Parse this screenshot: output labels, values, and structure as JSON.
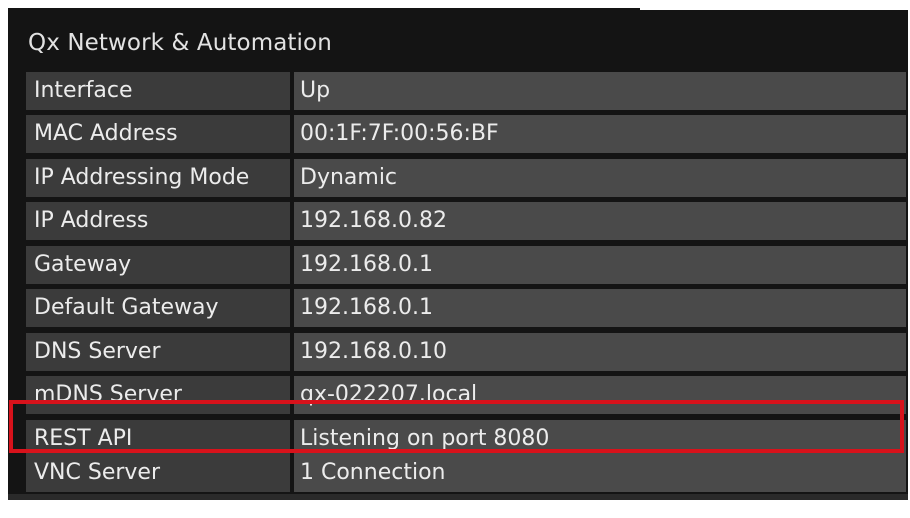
{
  "panel": {
    "title": "Qx Network & Automation"
  },
  "rows": [
    {
      "label": "Interface",
      "value": "Up"
    },
    {
      "label": "MAC Address",
      "value": "00:1F:7F:00:56:BF"
    },
    {
      "label": "IP Addressing Mode",
      "value": "Dynamic"
    },
    {
      "label": "IP Address",
      "value": "192.168.0.82"
    },
    {
      "label": "Gateway",
      "value": "192.168.0.1"
    },
    {
      "label": "Default Gateway",
      "value": "192.168.0.1"
    },
    {
      "label": "DNS Server",
      "value": "192.168.0.10"
    },
    {
      "label": "mDNS Server",
      "value": "qx-022207.local"
    },
    {
      "label": "REST API",
      "value": "Listening on port 8080"
    },
    {
      "label": "VNC Server",
      "value": "1 Connection"
    }
  ],
  "colors": {
    "highlight": "#d8121b",
    "label_bg": "#3b3b3b",
    "value_bg": "#4a4a4a"
  }
}
